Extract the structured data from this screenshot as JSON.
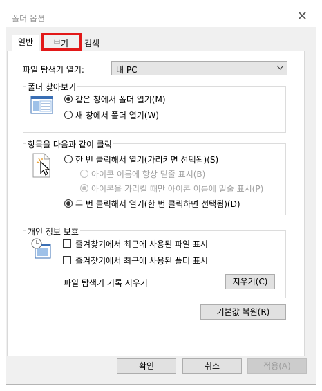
{
  "window": {
    "title": "폴더 옵션"
  },
  "tabs": [
    {
      "label": "일반",
      "active": true
    },
    {
      "label": "보기",
      "active": false,
      "highlighted": true
    },
    {
      "label": "검색",
      "active": false
    }
  ],
  "open_explorer": {
    "label": "파일 탐색기 열기:",
    "value": "내 PC"
  },
  "browse": {
    "legend": "폴더 찾아보기",
    "options": [
      {
        "label": "같은 창에서 폴더 열기(M)",
        "checked": true
      },
      {
        "label": "새 창에서 폴더 열기(W)",
        "checked": false
      }
    ]
  },
  "click": {
    "legend": "항목을 다음과 같이 클릭",
    "options": [
      {
        "label": "한 번 클릭해서 열기(가리키면 선택됨)(S)",
        "checked": false
      },
      {
        "label": "아이콘 이름에 항상 밑줄 표시(B)",
        "checked": false,
        "disabled": true
      },
      {
        "label": "아이콘을 가리킬 때만 아이콘 이름에 밑줄 표시(P)",
        "checked": true,
        "disabled": true
      },
      {
        "label": "두 번 클릭해서 열기(한 번 클릭하면 선택됨)(D)",
        "checked": true
      }
    ]
  },
  "privacy": {
    "legend": "개인 정보 보호",
    "options": [
      {
        "label": "즐겨찾기에서 최근에 사용된 파일 표시",
        "checked": false
      },
      {
        "label": "즐겨찾기에서 최근에 사용된 폴더 표시",
        "checked": false
      }
    ],
    "clear_label": "파일 탐색기 기록 지우기",
    "clear_button": "지우기(C)"
  },
  "restore_button": "기본값 복원(R)",
  "footer": {
    "ok": "확인",
    "cancel": "취소",
    "apply": "적용(A)"
  },
  "colors": {
    "highlight": "#e21818",
    "accent": "#0078d7"
  }
}
